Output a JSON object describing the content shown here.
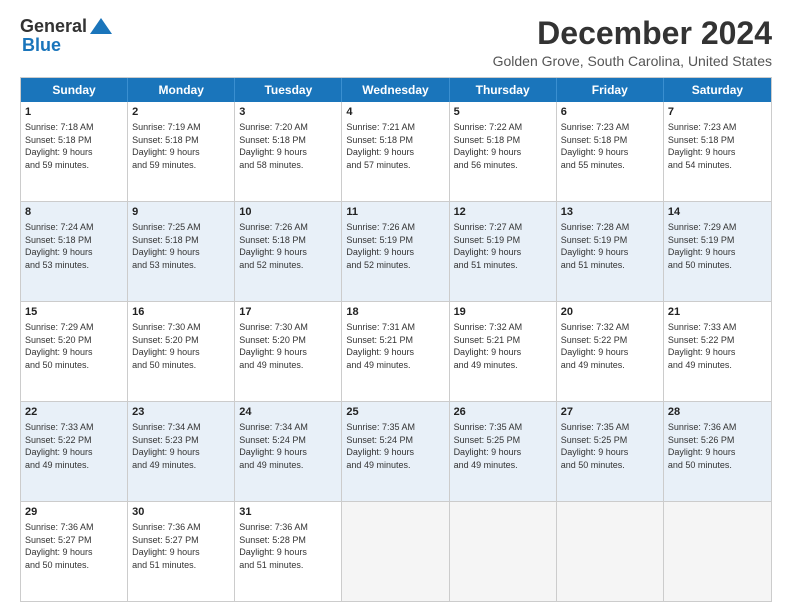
{
  "header": {
    "logo_general": "General",
    "logo_blue": "Blue",
    "month_title": "December 2024",
    "location": "Golden Grove, South Carolina, United States"
  },
  "weekdays": [
    "Sunday",
    "Monday",
    "Tuesday",
    "Wednesday",
    "Thursday",
    "Friday",
    "Saturday"
  ],
  "rows": [
    {
      "alt": false,
      "cells": [
        {
          "day": "1",
          "info": "Sunrise: 7:18 AM\nSunset: 5:18 PM\nDaylight: 9 hours\nand 59 minutes."
        },
        {
          "day": "2",
          "info": "Sunrise: 7:19 AM\nSunset: 5:18 PM\nDaylight: 9 hours\nand 59 minutes."
        },
        {
          "day": "3",
          "info": "Sunrise: 7:20 AM\nSunset: 5:18 PM\nDaylight: 9 hours\nand 58 minutes."
        },
        {
          "day": "4",
          "info": "Sunrise: 7:21 AM\nSunset: 5:18 PM\nDaylight: 9 hours\nand 57 minutes."
        },
        {
          "day": "5",
          "info": "Sunrise: 7:22 AM\nSunset: 5:18 PM\nDaylight: 9 hours\nand 56 minutes."
        },
        {
          "day": "6",
          "info": "Sunrise: 7:23 AM\nSunset: 5:18 PM\nDaylight: 9 hours\nand 55 minutes."
        },
        {
          "day": "7",
          "info": "Sunrise: 7:23 AM\nSunset: 5:18 PM\nDaylight: 9 hours\nand 54 minutes."
        }
      ]
    },
    {
      "alt": true,
      "cells": [
        {
          "day": "8",
          "info": "Sunrise: 7:24 AM\nSunset: 5:18 PM\nDaylight: 9 hours\nand 53 minutes."
        },
        {
          "day": "9",
          "info": "Sunrise: 7:25 AM\nSunset: 5:18 PM\nDaylight: 9 hours\nand 53 minutes."
        },
        {
          "day": "10",
          "info": "Sunrise: 7:26 AM\nSunset: 5:18 PM\nDaylight: 9 hours\nand 52 minutes."
        },
        {
          "day": "11",
          "info": "Sunrise: 7:26 AM\nSunset: 5:19 PM\nDaylight: 9 hours\nand 52 minutes."
        },
        {
          "day": "12",
          "info": "Sunrise: 7:27 AM\nSunset: 5:19 PM\nDaylight: 9 hours\nand 51 minutes."
        },
        {
          "day": "13",
          "info": "Sunrise: 7:28 AM\nSunset: 5:19 PM\nDaylight: 9 hours\nand 51 minutes."
        },
        {
          "day": "14",
          "info": "Sunrise: 7:29 AM\nSunset: 5:19 PM\nDaylight: 9 hours\nand 50 minutes."
        }
      ]
    },
    {
      "alt": false,
      "cells": [
        {
          "day": "15",
          "info": "Sunrise: 7:29 AM\nSunset: 5:20 PM\nDaylight: 9 hours\nand 50 minutes."
        },
        {
          "day": "16",
          "info": "Sunrise: 7:30 AM\nSunset: 5:20 PM\nDaylight: 9 hours\nand 50 minutes."
        },
        {
          "day": "17",
          "info": "Sunrise: 7:30 AM\nSunset: 5:20 PM\nDaylight: 9 hours\nand 49 minutes."
        },
        {
          "day": "18",
          "info": "Sunrise: 7:31 AM\nSunset: 5:21 PM\nDaylight: 9 hours\nand 49 minutes."
        },
        {
          "day": "19",
          "info": "Sunrise: 7:32 AM\nSunset: 5:21 PM\nDaylight: 9 hours\nand 49 minutes."
        },
        {
          "day": "20",
          "info": "Sunrise: 7:32 AM\nSunset: 5:22 PM\nDaylight: 9 hours\nand 49 minutes."
        },
        {
          "day": "21",
          "info": "Sunrise: 7:33 AM\nSunset: 5:22 PM\nDaylight: 9 hours\nand 49 minutes."
        }
      ]
    },
    {
      "alt": true,
      "cells": [
        {
          "day": "22",
          "info": "Sunrise: 7:33 AM\nSunset: 5:22 PM\nDaylight: 9 hours\nand 49 minutes."
        },
        {
          "day": "23",
          "info": "Sunrise: 7:34 AM\nSunset: 5:23 PM\nDaylight: 9 hours\nand 49 minutes."
        },
        {
          "day": "24",
          "info": "Sunrise: 7:34 AM\nSunset: 5:24 PM\nDaylight: 9 hours\nand 49 minutes."
        },
        {
          "day": "25",
          "info": "Sunrise: 7:35 AM\nSunset: 5:24 PM\nDaylight: 9 hours\nand 49 minutes."
        },
        {
          "day": "26",
          "info": "Sunrise: 7:35 AM\nSunset: 5:25 PM\nDaylight: 9 hours\nand 49 minutes."
        },
        {
          "day": "27",
          "info": "Sunrise: 7:35 AM\nSunset: 5:25 PM\nDaylight: 9 hours\nand 50 minutes."
        },
        {
          "day": "28",
          "info": "Sunrise: 7:36 AM\nSunset: 5:26 PM\nDaylight: 9 hours\nand 50 minutes."
        }
      ]
    },
    {
      "alt": false,
      "cells": [
        {
          "day": "29",
          "info": "Sunrise: 7:36 AM\nSunset: 5:27 PM\nDaylight: 9 hours\nand 50 minutes."
        },
        {
          "day": "30",
          "info": "Sunrise: 7:36 AM\nSunset: 5:27 PM\nDaylight: 9 hours\nand 51 minutes."
        },
        {
          "day": "31",
          "info": "Sunrise: 7:36 AM\nSunset: 5:28 PM\nDaylight: 9 hours\nand 51 minutes."
        },
        {
          "day": "",
          "info": ""
        },
        {
          "day": "",
          "info": ""
        },
        {
          "day": "",
          "info": ""
        },
        {
          "day": "",
          "info": ""
        }
      ]
    }
  ]
}
